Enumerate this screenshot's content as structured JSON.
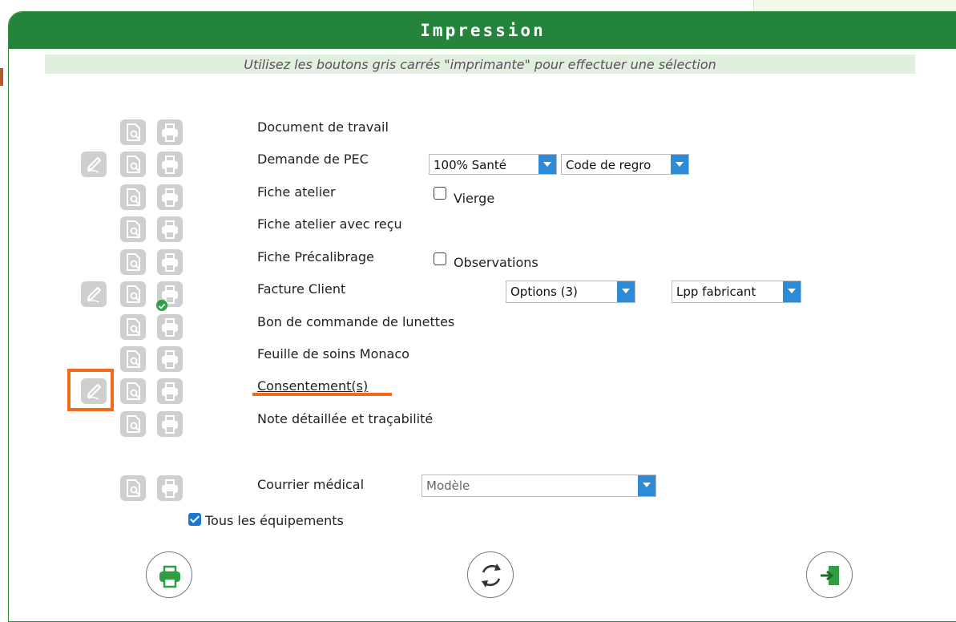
{
  "dialog": {
    "title": "Impression",
    "hint": "Utilisez les boutons gris carrés \"imprimante\" pour effectuer une sélection"
  },
  "rows": [
    {
      "label": "Document de travail"
    },
    {
      "label": "Demande de PEC"
    },
    {
      "label": "Fiche atelier"
    },
    {
      "label": "Fiche atelier avec reçu"
    },
    {
      "label": "Fiche Précalibrage"
    },
    {
      "label": "Facture Client"
    },
    {
      "label": "Bon de commande de lunettes"
    },
    {
      "label": "Feuille de soins Monaco"
    },
    {
      "label": "Consentement(s)"
    },
    {
      "label": "Note détaillée et traçabilité"
    }
  ],
  "pec": {
    "select1": "100% Santé",
    "select2": "Code de regro"
  },
  "fiche_atelier": {
    "checkbox_label": "Vierge",
    "checked": false
  },
  "precalibrage": {
    "checkbox_label": "Observations",
    "checked": false
  },
  "facture": {
    "options": "Options (3)",
    "lpp": "Lpp fabricant",
    "printed_status": "check"
  },
  "courrier": {
    "label": "Courrier médical",
    "placeholder": "Modèle"
  },
  "tous": {
    "label": "Tous les équipements",
    "checked": true
  },
  "colors": {
    "header": "#24843b",
    "accent": "#2d8ad6",
    "highlight": "#f26b1d",
    "icon_gray": "#cfcfcf"
  },
  "icons": {
    "edit": "pencil-icon",
    "preview": "document-preview-icon",
    "print": "printer-icon",
    "refresh": "refresh-icon",
    "exit": "exit-door-icon"
  }
}
